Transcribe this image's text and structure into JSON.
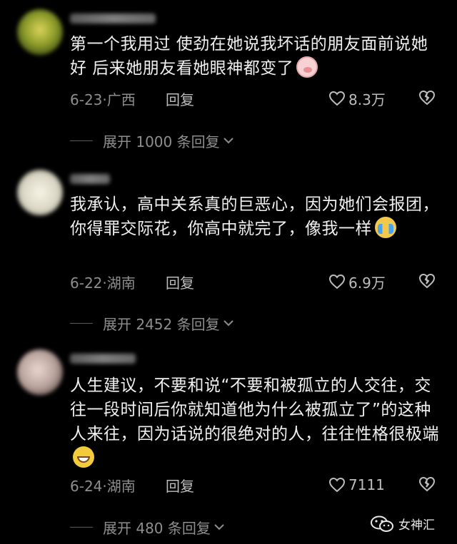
{
  "comments": [
    {
      "text": "第一个我用过 使劲在她说我坏话的朋友面前说她好 后来她朋友看她眼神都变了",
      "emoji": "pig-face-emoji",
      "date": "6-23",
      "location": "广西",
      "reply_label": "回复",
      "likes": "8.3万",
      "expand_label": "展开 1000 条回复"
    },
    {
      "text": "我承认，高中关系真的巨恶心，因为她们会报团，你得罪交际花，你高中就完了，像我一样",
      "emoji": "crying-face-emoji",
      "date": "6-22",
      "location": "湖南",
      "reply_label": "回复",
      "likes": "6.9万",
      "expand_label": "展开 2452 条回复"
    },
    {
      "text": "人生建议，不要和说“不要和被孤立的人交往，交往一段时间后你就知道他为什么被孤立了”的这种人来往，因为话说的很绝对的人，往往性格很极端",
      "emoji": "grinning-face-emoji",
      "date": "6-24",
      "location": "湖南",
      "reply_label": "回复",
      "likes": "7111",
      "expand_label": "展开 480 条回复"
    }
  ],
  "watermark": {
    "text": "女神汇",
    "icon": "wechat-icon"
  },
  "colors": {
    "background": "#000000",
    "text": "#f0f0f0",
    "muted": "#8e8e8e"
  }
}
